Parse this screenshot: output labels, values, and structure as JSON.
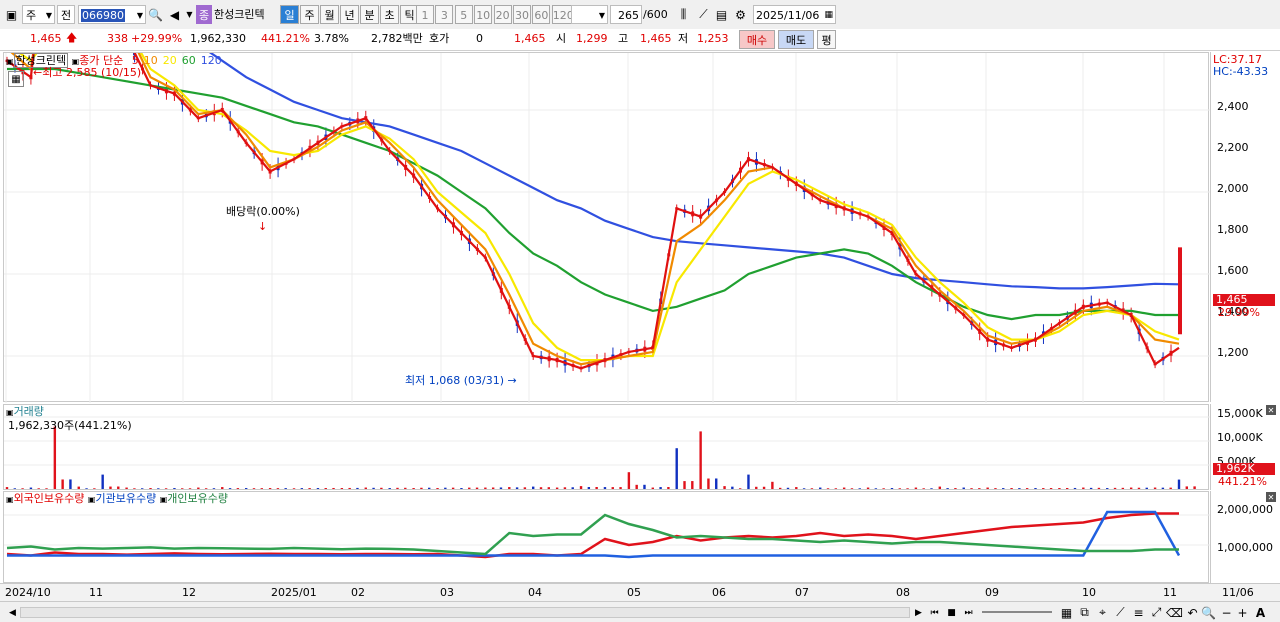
{
  "toolbar": {
    "market": "주",
    "prefix": "전",
    "code": "066980",
    "name": "한성크린텍",
    "periods": [
      "일",
      "주",
      "월",
      "년",
      "분",
      "초",
      "틱"
    ],
    "intervals": [
      "1",
      "3",
      "5",
      "10",
      "20",
      "30",
      "60",
      "120"
    ],
    "count": "265",
    "total": "/600",
    "date": "2025/11/06"
  },
  "quote": {
    "price": "1,465",
    "change": "338",
    "change_pct": "+29.99%",
    "volume": "1,962,330",
    "vol_ratio": "441.21%",
    "turnover": "3.78%",
    "amount": "2,782백만",
    "bid_label": "호가",
    "bid_value": "0",
    "ask": "1,465",
    "open_label": "시",
    "open": "1,299",
    "high_label": "고",
    "high": "1,465",
    "low_label": "저",
    "low": "1,253",
    "buy_label": "매수",
    "sell_label": "매도",
    "avg_label": "평"
  },
  "price_panel": {
    "stock_tag": "한성크린텍",
    "legend_label": "종가 단순",
    "ma_periods": [
      "5",
      "10",
      "20",
      "60",
      "120"
    ],
    "lc": "LC:37.17",
    "hc": "HC:-43.33",
    "high_note": "최고 2,585 (10/15)",
    "low_note": "최저 1,068 (03/31)",
    "dividend_note": "배당락(0.00%)",
    "y_ticks": [
      "2,400",
      "2,200",
      "2,000",
      "1,800",
      "1,600",
      "1,400",
      "1,200"
    ],
    "last_tag": "1,465",
    "pct_tag": "29.99%"
  },
  "volume_panel": {
    "title": "거래량",
    "readout": "1,962,330주(441.21%)",
    "y_ticks": [
      "15,000K",
      "10,000K",
      "5,000K"
    ],
    "last_tag": "1,962K",
    "pct_tag": "441.21%"
  },
  "holdings_panel": {
    "legend": [
      "외국인보유수량",
      "기관보유수량",
      "개인보유수량"
    ],
    "y_ticks": [
      "2,000,000",
      "1,000,000"
    ]
  },
  "x_axis": {
    "labels": [
      "2024/10",
      "11",
      "12",
      "2025/01",
      "02",
      "03",
      "04",
      "05",
      "06",
      "07",
      "08",
      "09",
      "10",
      "11"
    ],
    "last": "11/06"
  },
  "colors": {
    "up": "#e0121b",
    "down": "#1030c0",
    "ma5": "#e01010",
    "ma10": "#f08a00",
    "ma20": "#f8e800",
    "ma60": "#20a030",
    "ma120": "#3050e0"
  },
  "chart_data": {
    "type": "line",
    "title": "한성크린텍",
    "ylim": [
      1000,
      2585
    ],
    "series": [
      {
        "name": "5",
        "values": [
          1920,
          1880,
          2400,
          2260,
          2100,
          1980,
          1860,
          1840,
          1780,
          1800,
          1720,
          1650,
          1680,
          1720,
          1760,
          1780,
          1700,
          1640,
          1560,
          1500,
          1440,
          1320,
          1200,
          1190,
          1170,
          1190,
          1210,
          1220,
          1560,
          1540,
          1600,
          1680,
          1660,
          1620,
          1580,
          1560,
          1540,
          1500,
          1400,
          1350,
          1300,
          1240,
          1220,
          1240,
          1280,
          1320,
          1330,
          1300,
          1180,
          1220
        ]
      },
      {
        "name": "10",
        "values": [
          1950,
          1900,
          2300,
          2280,
          2150,
          2000,
          1880,
          1850,
          1790,
          1800,
          1740,
          1660,
          1680,
          1710,
          1750,
          1770,
          1720,
          1660,
          1580,
          1520,
          1460,
          1350,
          1230,
          1200,
          1180,
          1190,
          1200,
          1210,
          1480,
          1520,
          1580,
          1650,
          1660,
          1620,
          1590,
          1560,
          1540,
          1510,
          1420,
          1360,
          1310,
          1250,
          1230,
          1240,
          1270,
          1310,
          1320,
          1300,
          1240,
          1230
        ]
      },
      {
        "name": "20",
        "values": [
          1960,
          1920,
          2000,
          2150,
          2100,
          2000,
          1900,
          1860,
          1800,
          1790,
          1750,
          1700,
          1690,
          1700,
          1740,
          1760,
          1730,
          1680,
          1600,
          1550,
          1500,
          1400,
          1280,
          1220,
          1190,
          1190,
          1200,
          1200,
          1380,
          1460,
          1540,
          1620,
          1650,
          1630,
          1600,
          1570,
          1550,
          1520,
          1440,
          1380,
          1330,
          1270,
          1240,
          1240,
          1260,
          1300,
          1310,
          1300,
          1260,
          1240
        ]
      },
      {
        "name": "60",
        "values": [
          1900,
          1900,
          1900,
          1890,
          1880,
          1870,
          1860,
          1850,
          1840,
          1830,
          1810,
          1790,
          1770,
          1760,
          1740,
          1720,
          1700,
          1670,
          1640,
          1600,
          1560,
          1500,
          1450,
          1420,
          1380,
          1350,
          1330,
          1310,
          1320,
          1340,
          1360,
          1400,
          1420,
          1440,
          1450,
          1460,
          1450,
          1420,
          1380,
          1350,
          1320,
          1300,
          1290,
          1300,
          1300,
          1310,
          1310,
          1310,
          1300,
          1300
        ]
      },
      {
        "name": "120",
        "values": [
          2300,
          2270,
          2240,
          2200,
          2150,
          2100,
          2050,
          2000,
          1960,
          1920,
          1880,
          1850,
          1820,
          1800,
          1780,
          1770,
          1760,
          1740,
          1720,
          1700,
          1670,
          1640,
          1610,
          1580,
          1560,
          1530,
          1510,
          1490,
          1480,
          1475,
          1470,
          1465,
          1460,
          1455,
          1450,
          1440,
          1420,
          1400,
          1390,
          1385,
          1380,
          1375,
          1370,
          1368,
          1365,
          1365,
          1368,
          1372,
          1376,
          1375
        ]
      }
    ],
    "holdings": [
      {
        "name": "외국인보유수량",
        "values": [
          700000,
          650000,
          750000,
          700000,
          700000,
          680000,
          700000,
          720000,
          700000,
          690000,
          700000,
          710000,
          700000,
          700000,
          690000,
          700000,
          700000,
          690000,
          700000,
          650000,
          600000,
          700000,
          700000,
          650000,
          700000,
          1200000,
          1000000,
          1100000,
          1300000,
          1150000,
          1250000,
          1300000,
          1250000,
          1300000,
          1400000,
          1300000,
          1350000,
          1300000,
          1200000,
          1300000,
          1400000,
          1500000,
          1600000,
          1650000,
          1700000,
          1750000,
          1900000,
          2000000,
          2050000,
          2050000
        ]
      },
      {
        "name": "기관보유수량",
        "values": [
          650000,
          650000,
          650000,
          650000,
          650000,
          650000,
          650000,
          650000,
          650000,
          650000,
          650000,
          650000,
          650000,
          650000,
          650000,
          650000,
          650000,
          650000,
          650000,
          650000,
          650000,
          650000,
          650000,
          650000,
          650000,
          650000,
          600000,
          650000,
          650000,
          650000,
          650000,
          650000,
          650000,
          650000,
          650000,
          650000,
          650000,
          650000,
          650000,
          650000,
          650000,
          650000,
          650000,
          650000,
          650000,
          650000,
          2100000,
          2100000,
          2100000,
          650000
        ]
      },
      {
        "name": "개인보유수량",
        "values": [
          900000,
          950000,
          850000,
          900000,
          880000,
          900000,
          920000,
          880000,
          900000,
          890000,
          880000,
          870000,
          900000,
          880000,
          860000,
          880000,
          870000,
          850000,
          800000,
          750000,
          700000,
          1400000,
          1300000,
          1350000,
          1350000,
          2000000,
          1700000,
          1500000,
          1250000,
          1300000,
          1250000,
          1200000,
          1200000,
          1150000,
          1100000,
          1150000,
          1100000,
          1050000,
          1100000,
          1100000,
          1050000,
          1000000,
          950000,
          900000,
          850000,
          800000,
          800000,
          800000,
          850000,
          850000
        ]
      }
    ],
    "volume_k": [
      400,
      300,
      13000,
      500,
      3000,
      300,
      200,
      200,
      300,
      400,
      200,
      200,
      150,
      200,
      200,
      300,
      200,
      200,
      200,
      200,
      300,
      400,
      500,
      300,
      600,
      400,
      3500,
      300,
      8500,
      12000,
      600,
      3000,
      1500,
      400,
      300,
      300,
      300,
      200,
      300,
      500,
      300,
      300,
      200,
      200,
      200,
      300,
      200,
      300,
      300,
      1962
    ]
  }
}
